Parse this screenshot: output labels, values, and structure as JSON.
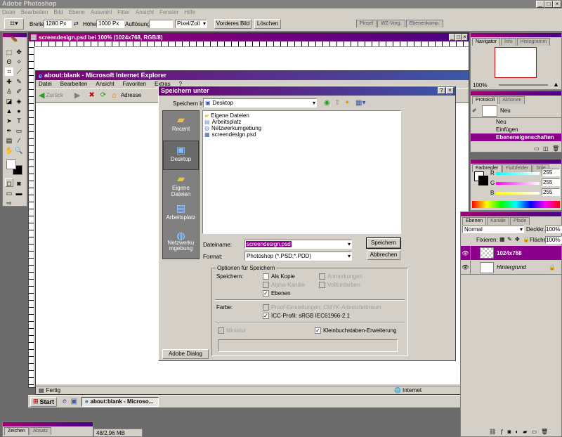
{
  "ps": {
    "title": "Adobe Photoshop",
    "menu": [
      "Datei",
      "Bearbeiten",
      "Bild",
      "Ebene",
      "Auswahl",
      "Filter",
      "Ansicht",
      "Fenster",
      "Hilfe"
    ],
    "options": {
      "breite_label": "Breite:",
      "breite_value": "1280 Px",
      "hoehe_label": "Höhe:",
      "hoehe_value": "1000 Px",
      "aufloesung_label": "Auflösung:",
      "aufloesung_value": "",
      "unit": "Pixel/Zoll",
      "front_btn": "Vorderes Bild",
      "clear_btn": "Löschen",
      "well_tabs": [
        "Pinsel",
        "WZ-Vorg.",
        "Ebenenkomp."
      ]
    },
    "doc_title": "screendesign.psd bei 100% (1024x768, RGB/8)",
    "status_text": "48/2,96 MB",
    "zeichen_tabs": [
      "Zeichen",
      "Absatz"
    ]
  },
  "ie": {
    "title": "about:blank - Microsoft Internet Explorer",
    "menu": [
      "Datei",
      "Bearbeiten",
      "Ansicht",
      "Favoriten",
      "Extras",
      "?"
    ],
    "back": "Zurück",
    "address_label": "Adresse",
    "status": "Fertig",
    "zone": "Internet"
  },
  "dialog": {
    "title": "Speichern unter",
    "savein_label": "Speichern in:",
    "savein_value": "Desktop",
    "places": [
      "Recent",
      "Desktop",
      "Eigene Dateien",
      "Arbeitsplatz",
      "Netzwerkumgebung"
    ],
    "files": [
      "Eigene Dateien",
      "Arbeitsplatz",
      "Netzwerkumgebung",
      "screendesign.psd"
    ],
    "filename_label": "Dateiname:",
    "filename_value": "screendesign.psd",
    "format_label": "Format:",
    "format_value": "Photoshop (*.PSD;*.PDD)",
    "save_btn": "Speichern",
    "cancel_btn": "Abbrechen",
    "options_title": "Optionen für Speichern",
    "speichern_label": "Speichern:",
    "opts": {
      "als_kopie": "Als Kopie",
      "alpha": "Alpha-Kanäle",
      "ebenen": "Ebenen",
      "anmerkungen": "Anmerkungen",
      "volltonfarben": "Volltonfarben"
    },
    "farbe_label": "Farbe:",
    "proof": "Proof-Einstellungen: CMYK-Arbeitsfarbraum",
    "icc": "ICC-Profil: sRGB IEC61966-2.1",
    "miniatur": "Miniatur",
    "kleinbuchstaben": "Kleinbuchstaben-Erweiterung",
    "adobe_btn": "Adobe Dialog"
  },
  "nav": {
    "tabs": [
      "Navigator",
      "Info",
      "Histogramm"
    ],
    "zoom": "100%"
  },
  "protokoll": {
    "tabs": [
      "Protokoll",
      "Aktionen"
    ],
    "snapshot": "Neu",
    "items": [
      "Neu",
      "Einfügen",
      "Ebeneneigenschaften"
    ]
  },
  "farb": {
    "tabs": [
      "Farbregler",
      "Farbfelder",
      "Stile"
    ],
    "r_label": "R",
    "r": "255",
    "g_label": "G",
    "g": "255",
    "b_label": "B",
    "b": "255"
  },
  "ebenen": {
    "tabs": [
      "Ebenen",
      "Kanäle",
      "Pfade"
    ],
    "mode": "Normal",
    "deckkraft_label": "Deckkr.:",
    "deckkraft": "100%",
    "fixieren_label": "Fixieren:",
    "flaeche_label": "Fläche:",
    "flaeche": "100%",
    "layers": [
      "1024x768",
      "Hintergrund"
    ]
  },
  "taskbar": {
    "start": "Start",
    "item": "about:blank - Microso..."
  },
  "colors": {
    "accent": "#8b008b",
    "selection": "#3a58a8"
  }
}
